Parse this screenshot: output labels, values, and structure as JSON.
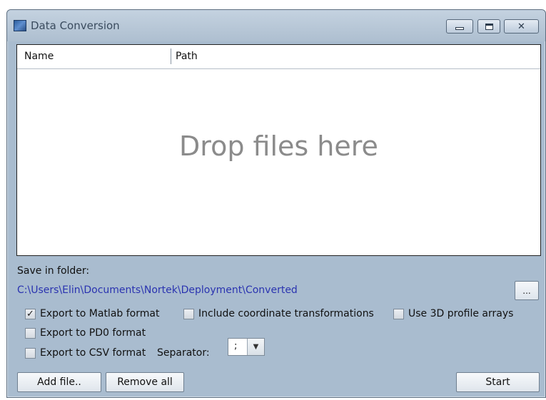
{
  "window": {
    "title": "Data Conversion",
    "controls": [
      "minimize",
      "maximize",
      "close"
    ]
  },
  "file_list": {
    "columns": [
      "Name",
      "Path"
    ],
    "empty_text": "Drop files here"
  },
  "save": {
    "label": "Save in folder:",
    "path": "C:\\Users\\Elin\\Documents\\Nortek\\Deployment\\Converted",
    "browse_label": "..."
  },
  "options": {
    "matlab": {
      "label": "Export to Matlab format",
      "checked": true
    },
    "coord": {
      "label": "Include coordinate transformations",
      "checked": false
    },
    "profile3d": {
      "label": "Use 3D profile arrays",
      "checked": false
    },
    "pd0": {
      "label": "Export to PD0 format",
      "checked": false
    },
    "csv": {
      "label": "Export to CSV format",
      "checked": false
    },
    "separator_label": "Separator:",
    "separator_value": ";"
  },
  "buttons": {
    "add_file": "Add file..",
    "remove_all": "Remove all",
    "start": "Start"
  },
  "colors": {
    "window_bg": "#a9bccf",
    "path_text": "#2a33b0",
    "drop_text": "#8b8b8b"
  }
}
